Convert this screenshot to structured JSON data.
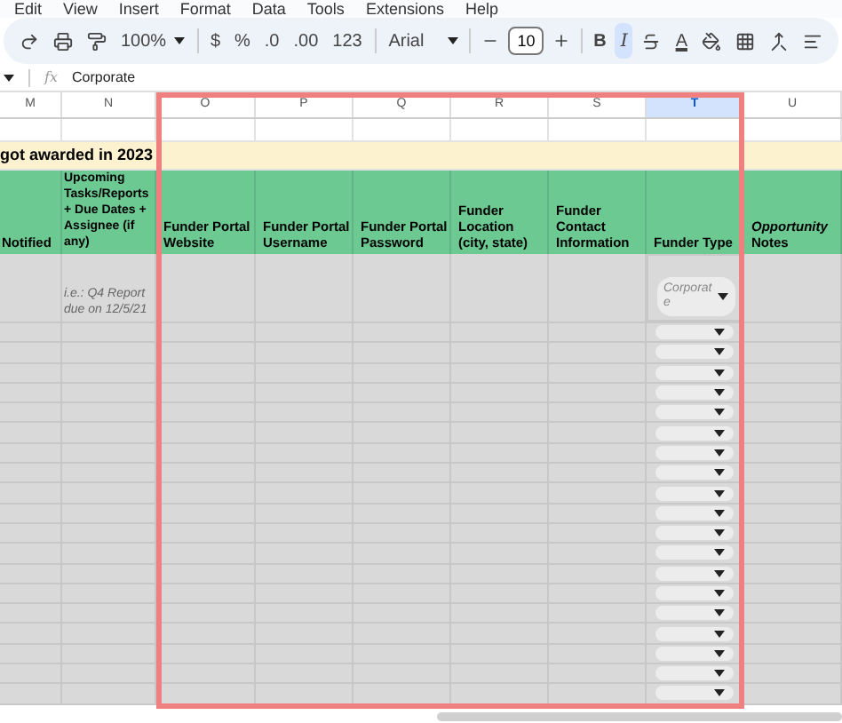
{
  "menu": [
    "Edit",
    "View",
    "Insert",
    "Format",
    "Data",
    "Tools",
    "Extensions",
    "Help"
  ],
  "toolbar": {
    "zoom": "100%",
    "currency": "$",
    "percent": "%",
    "decrease_decimals": ".0",
    "increase_decimals": ".00",
    "number_format": "123",
    "font": "Arial",
    "font_size": "10",
    "bold": {
      "label": "B",
      "on": false
    },
    "italic": {
      "label": "I",
      "on": true
    },
    "text_color": "A"
  },
  "formula_bar": {
    "label": "fx",
    "value": "Corporate"
  },
  "columns": [
    {
      "label": "M",
      "selected": false
    },
    {
      "label": "N",
      "selected": false
    },
    {
      "label": "O",
      "selected": false
    },
    {
      "label": "P",
      "selected": false
    },
    {
      "label": "Q",
      "selected": false
    },
    {
      "label": "R",
      "selected": false
    },
    {
      "label": "S",
      "selected": false
    },
    {
      "label": "T",
      "selected": true
    },
    {
      "label": "U",
      "selected": false
    }
  ],
  "banner": "got awarded in 2023",
  "headers": [
    "Notified",
    "Upcoming Tasks/Reports + Due Dates + Assignee (if any)",
    "Funder Portal Website",
    "Funder Portal Username",
    "Funder Portal Password",
    "Funder Location (city, state)",
    "Funder Contact Information",
    "Funder Type",
    "*Opportunity* Notes"
  ],
  "example_row": {
    "tasks_hint": "i.e.: Q4 Report due on 12/5/21",
    "funder_type": "Corporate",
    "funder_type_selected": true
  },
  "empty_rows": [
    {
      "kind": "dropdown"
    },
    {
      "kind": "dropdown"
    },
    {
      "kind": "dropdown"
    },
    {
      "kind": "dropdown"
    },
    {
      "kind": "dropdown"
    },
    {
      "kind": "dropdown"
    },
    {
      "kind": "dropdown"
    },
    {
      "kind": "dropdown"
    },
    {
      "kind": "dropdown"
    },
    {
      "kind": "dropdown"
    },
    {
      "kind": "dropdown"
    },
    {
      "kind": "dropdown"
    },
    {
      "kind": "dropdown"
    },
    {
      "kind": "dropdown"
    },
    {
      "kind": "dropdown"
    },
    {
      "kind": "dropdown"
    },
    {
      "kind": "dropdown"
    },
    {
      "kind": "dropdown"
    },
    {
      "kind": "dropdown"
    }
  ]
}
